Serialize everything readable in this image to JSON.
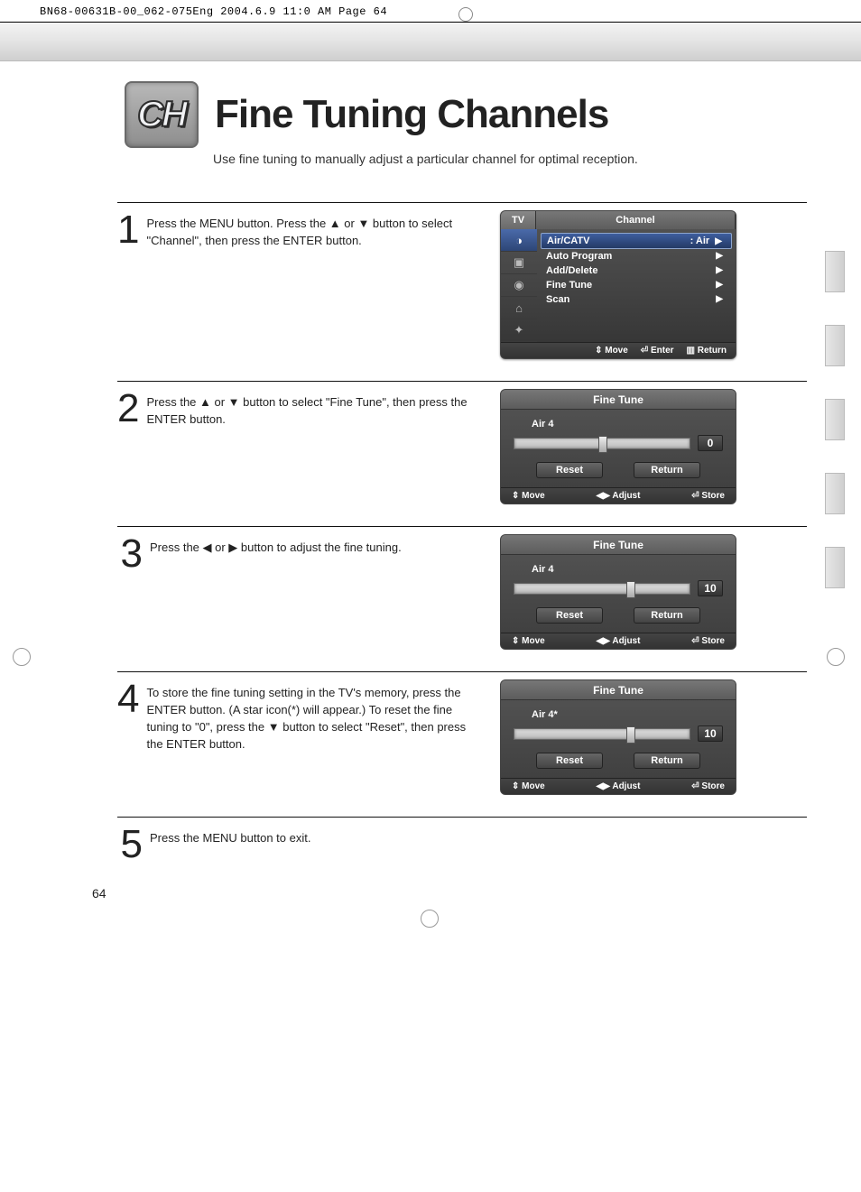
{
  "print_header": "BN68-00631B-00_062-075Eng  2004.6.9  11:0 AM  Page 64",
  "badge": "CH",
  "title": "Fine Tuning Channels",
  "subtitle": "Use fine tuning to manually adjust a particular channel for optimal reception.",
  "page_number": "64",
  "steps": [
    {
      "num": "1",
      "text": "Press the MENU button. Press the ▲ or ▼ button to select \"Channel\", then press the ENTER button."
    },
    {
      "num": "2",
      "text": "Press the ▲ or ▼ button to select \"Fine Tune\", then press the ENTER button."
    },
    {
      "num": "3",
      "text": "Press the ◀ or ▶ button to adjust the fine tuning."
    },
    {
      "num": "4",
      "text": "To store the fine tuning setting in the TV's memory, press the ENTER button. (A star icon(*) will appear.) To reset the fine tuning to \"0\", press the ▼ button to select \"Reset\", then press the ENTER button."
    },
    {
      "num": "5",
      "text": "Press the MENU button to exit."
    }
  ],
  "osd_channel": {
    "tab_left": "TV",
    "tab_main": "Channel",
    "items": [
      {
        "label": "Air/CATV",
        "value": ":  Air"
      },
      {
        "label": "Auto Program",
        "value": ""
      },
      {
        "label": "Add/Delete",
        "value": ""
      },
      {
        "label": "Fine Tune",
        "value": ""
      },
      {
        "label": "Scan",
        "value": ""
      }
    ],
    "footer": {
      "move": "Move",
      "enter": "Enter",
      "return": "Return"
    }
  },
  "finetune_title": "Fine Tune",
  "finetune_buttons": {
    "reset": "Reset",
    "return": "Return"
  },
  "finetune_footer": {
    "move": "Move",
    "adjust": "Adjust",
    "store": "Store"
  },
  "ft_screens": [
    {
      "channel": "Air   4",
      "value": "0",
      "thumb_pct": 48
    },
    {
      "channel": "Air   4",
      "value": "10",
      "thumb_pct": 64
    },
    {
      "channel": "Air   4*",
      "value": "10",
      "thumb_pct": 64
    }
  ]
}
